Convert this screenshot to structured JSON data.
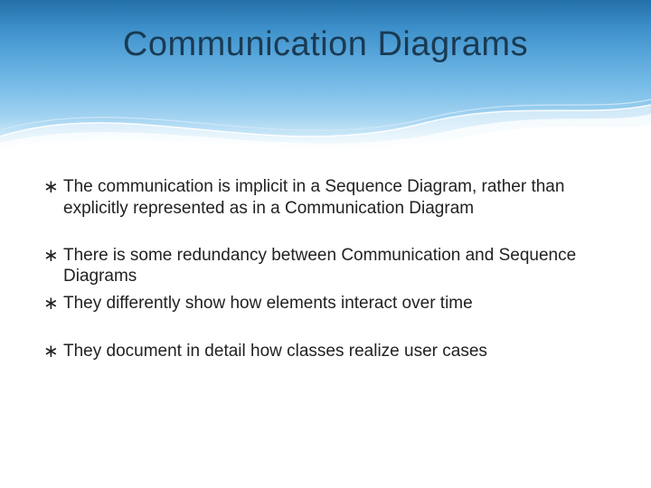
{
  "title": "Communication Diagrams",
  "bullets": {
    "b0": "The communication is implicit in a Sequence Diagram, rather than explicitly represented as in a Communication Diagram",
    "b1": "There is some redundancy between Communication and Sequence Diagrams",
    "b2": "They differently show how elements interact over time",
    "b3": "They document in detail how classes realize user cases"
  },
  "bullet_glyph": "∗"
}
